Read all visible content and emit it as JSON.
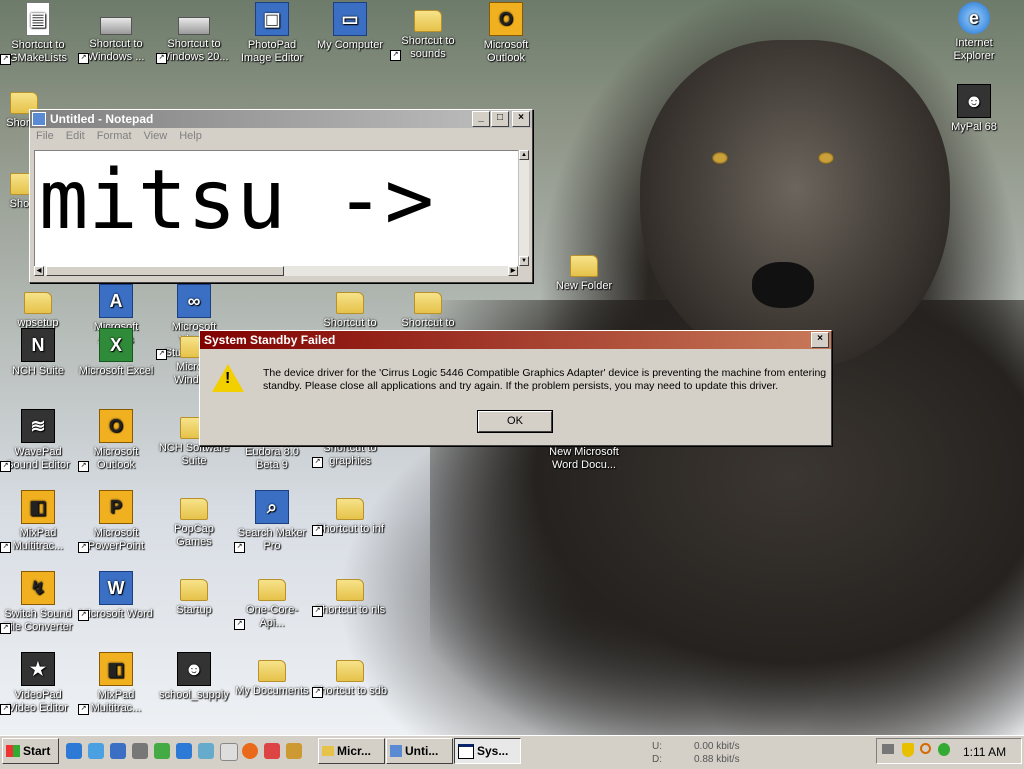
{
  "desktop": {
    "icons": [
      {
        "label": "Shortcut to\nGMakeLists",
        "glyph": "▤",
        "style": "doc"
      },
      {
        "label": "Shortcut to\nWindows ...",
        "glyph": "",
        "style": "drive"
      },
      {
        "label": "Shortcut to\nWindows 20...",
        "glyph": "",
        "style": "drive"
      },
      {
        "label": "PhotoPad\nImage Editor",
        "glyph": "▣",
        "style": "app"
      },
      {
        "label": "My Computer",
        "glyph": "▭",
        "style": "app"
      },
      {
        "label": "Shortcut to\nsounds",
        "glyph": "",
        "style": "folder"
      },
      {
        "label": "Microsoft\nOutlook",
        "glyph": "O",
        "style": "gold"
      },
      {
        "label": "Internet\nExplorer",
        "glyph": "e",
        "style": "ie"
      },
      {
        "label": "MyPal 68",
        "glyph": "☻",
        "style": "dark"
      },
      {
        "label": "wpsetup",
        "glyph": "",
        "style": "folder"
      },
      {
        "label": "Microsoft\nAccess",
        "glyph": "A",
        "style": "app"
      },
      {
        "label": "Microsoft Visual\nStudio 2008",
        "glyph": "∞",
        "style": "app"
      },
      {
        "label": "Shortcut to\nfonts",
        "glyph": "",
        "style": "folder"
      },
      {
        "label": "Shortcut to\nvgafonts",
        "glyph": "",
        "style": "folder"
      },
      {
        "label": "New Folder",
        "glyph": "",
        "style": "folder"
      },
      {
        "label": "NCH Suite",
        "glyph": "N",
        "style": "dark"
      },
      {
        "label": "Microsoft Excel",
        "glyph": "X",
        "style": "green"
      },
      {
        "label": "Micro...\nWindo...",
        "glyph": "",
        "style": "folder"
      },
      {
        "label": "WavePad\nSound Editor",
        "glyph": "≋",
        "style": "dark"
      },
      {
        "label": "Microsoft\nOutlook",
        "glyph": "O",
        "style": "gold"
      },
      {
        "label": "NCH Software\nSuite",
        "glyph": "",
        "style": "folder"
      },
      {
        "label": "Eudora 8.0\nBeta 9",
        "glyph": "✉",
        "style": "app"
      },
      {
        "label": "Shortcut to\ngraphics",
        "glyph": "",
        "style": "folder"
      },
      {
        "label": "New Microsoft\nWord Docu...",
        "glyph": "W",
        "style": "app"
      },
      {
        "label": "MixPad\nMultitrac...",
        "glyph": "◧",
        "style": "gold"
      },
      {
        "label": "Microsoft\nPowerPoint",
        "glyph": "P",
        "style": "gold"
      },
      {
        "label": "PopCap Games",
        "glyph": "",
        "style": "folder"
      },
      {
        "label": "Search Maker\nPro",
        "glyph": "⌕",
        "style": "app"
      },
      {
        "label": "Shortcut to inf",
        "glyph": "",
        "style": "folder"
      },
      {
        "label": "Switch Sound\nFile Converter",
        "glyph": "↯",
        "style": "gold"
      },
      {
        "label": "Microsoft Word",
        "glyph": "W",
        "style": "app"
      },
      {
        "label": "Startup",
        "glyph": "",
        "style": "folder"
      },
      {
        "label": "One-Core-Api...",
        "glyph": "",
        "style": "folder"
      },
      {
        "label": "Shortcut to nls",
        "glyph": "",
        "style": "folder"
      },
      {
        "label": "VideoPad\nVideo Editor",
        "glyph": "★",
        "style": "dark"
      },
      {
        "label": "MixPad\nMultitrac...",
        "glyph": "◧",
        "style": "gold"
      },
      {
        "label": "school_supply",
        "glyph": "☻",
        "style": "dark"
      },
      {
        "label": "My Documents",
        "glyph": "",
        "style": "folder"
      },
      {
        "label": "Shortcut to sdb",
        "glyph": "",
        "style": "folder"
      },
      {
        "label": "Short...",
        "glyph": "",
        "style": "folder"
      },
      {
        "label": "Sho...",
        "glyph": "",
        "style": "folder"
      }
    ]
  },
  "notepad": {
    "title": "Untitled - Notepad",
    "menu": [
      "File",
      "Edit",
      "Format",
      "View",
      "Help"
    ],
    "text": "mitsu ->"
  },
  "dialog": {
    "title": "System Standby Failed",
    "message": "The device driver for the 'Cirrus Logic 5446 Compatible Graphics Adapter' device is preventing the machine from entering standby. Please close all applications and try again. If the problem persists, you may need to update this driver.",
    "ok_label": "OK"
  },
  "taskbar": {
    "start_label": "Start",
    "items": [
      "Micr...",
      "Unti...",
      "Sys..."
    ],
    "network": {
      "u_label": "U:",
      "d_label": "D:",
      "u_value": "0.00 kbit/s",
      "d_value": "0.88 kbit/s"
    },
    "clock": "1:11 AM"
  },
  "colors": {
    "dialog_title_start": "#800000",
    "dialog_title_end": "#c87a5a",
    "face": "#d4d0c8"
  }
}
